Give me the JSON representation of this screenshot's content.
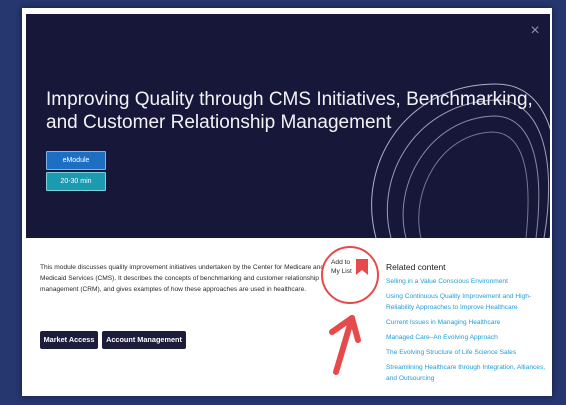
{
  "modal": {
    "close_glyph": "×",
    "title": "Improving Quality through CMS Initiatives, Benchmarking, and Customer Relationship Management",
    "badges": {
      "type": "eModule",
      "duration": "20-30 min"
    },
    "description": "This module discusses quality improvement initiatives undertaken by the Center for Medicare and Medicaid Services (CMS). It describes the concepts of benchmarking and customer relationship management (CRM), and gives examples of how these approaches are used in healthcare.",
    "add_to_list": {
      "line1": "Add to",
      "line2": "My List",
      "icon": "bookmark-icon"
    },
    "tags": [
      "Market Access",
      "Account Management"
    ],
    "related": {
      "heading": "Related content",
      "items": [
        "Selling in a Value Conscious Environment",
        "Using Continuous Quality Improvement and High-Reliability Approaches to Improve Healthcare",
        "Current Issues in Managing Healthcare",
        "Managed Care–An Evolving Approach",
        "The Evolving Structure of Life Science Sales",
        "Streamlining Healthcare through Integration, Alliances, and Outsourcing"
      ]
    }
  },
  "colors": {
    "hero_background": "#161739",
    "link": "#1e9bd7",
    "annotation": "#e74a4a",
    "tag_background": "#1b1d3a"
  }
}
